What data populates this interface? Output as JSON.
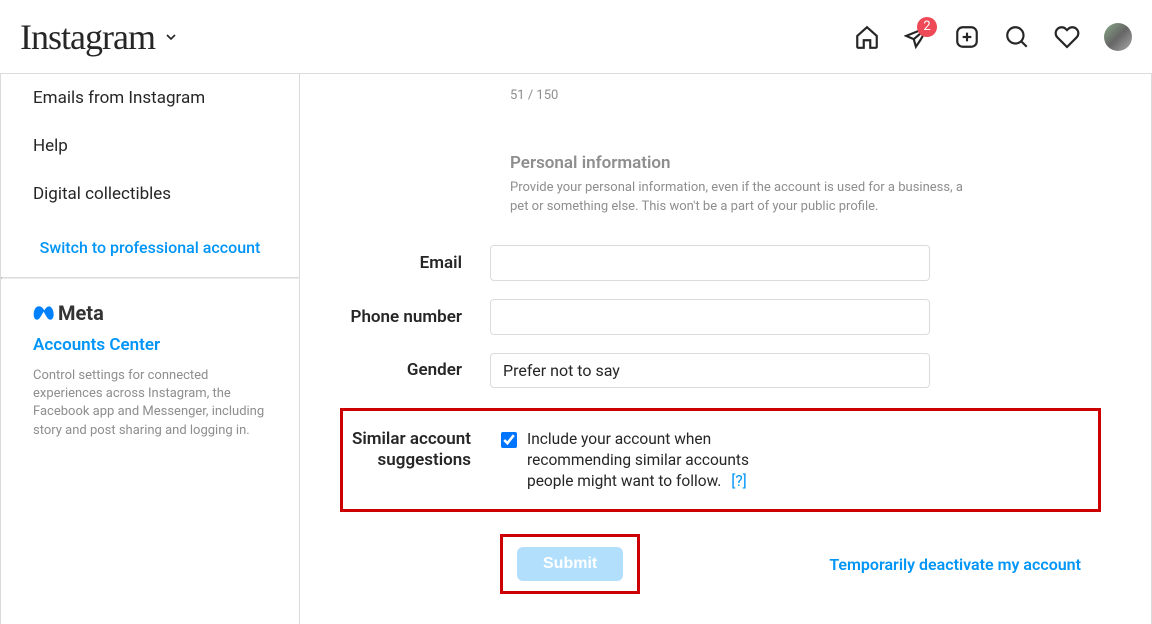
{
  "brand": {
    "name": "Instagram"
  },
  "nav": {
    "badge": "2"
  },
  "sidebar": {
    "items": [
      "Emails from Instagram",
      "Help",
      "Digital collectibles"
    ],
    "switch_link": "Switch to professional account",
    "meta": {
      "brand": "Meta",
      "accounts_center": "Accounts Center",
      "description": "Control settings for connected experiences across Instagram, the Facebook app and Messenger, including story and post sharing and logging in."
    }
  },
  "main": {
    "char_count": "51 / 150",
    "personal_info": {
      "title": "Personal information",
      "description": "Provide your personal information, even if the account is used for a business, a pet or something else. This won't be a part of your public profile."
    },
    "fields": {
      "email_label": "Email",
      "email_value": "",
      "phone_label": "Phone number",
      "phone_value": "",
      "gender_label": "Gender",
      "gender_value": "Prefer not to say"
    },
    "similar": {
      "label": "Similar account suggestions",
      "text": "Include your account when recommending similar accounts people might want to follow.",
      "help": "[?]",
      "checked": true
    },
    "submit": "Submit",
    "deactivate": "Temporarily deactivate my account"
  }
}
